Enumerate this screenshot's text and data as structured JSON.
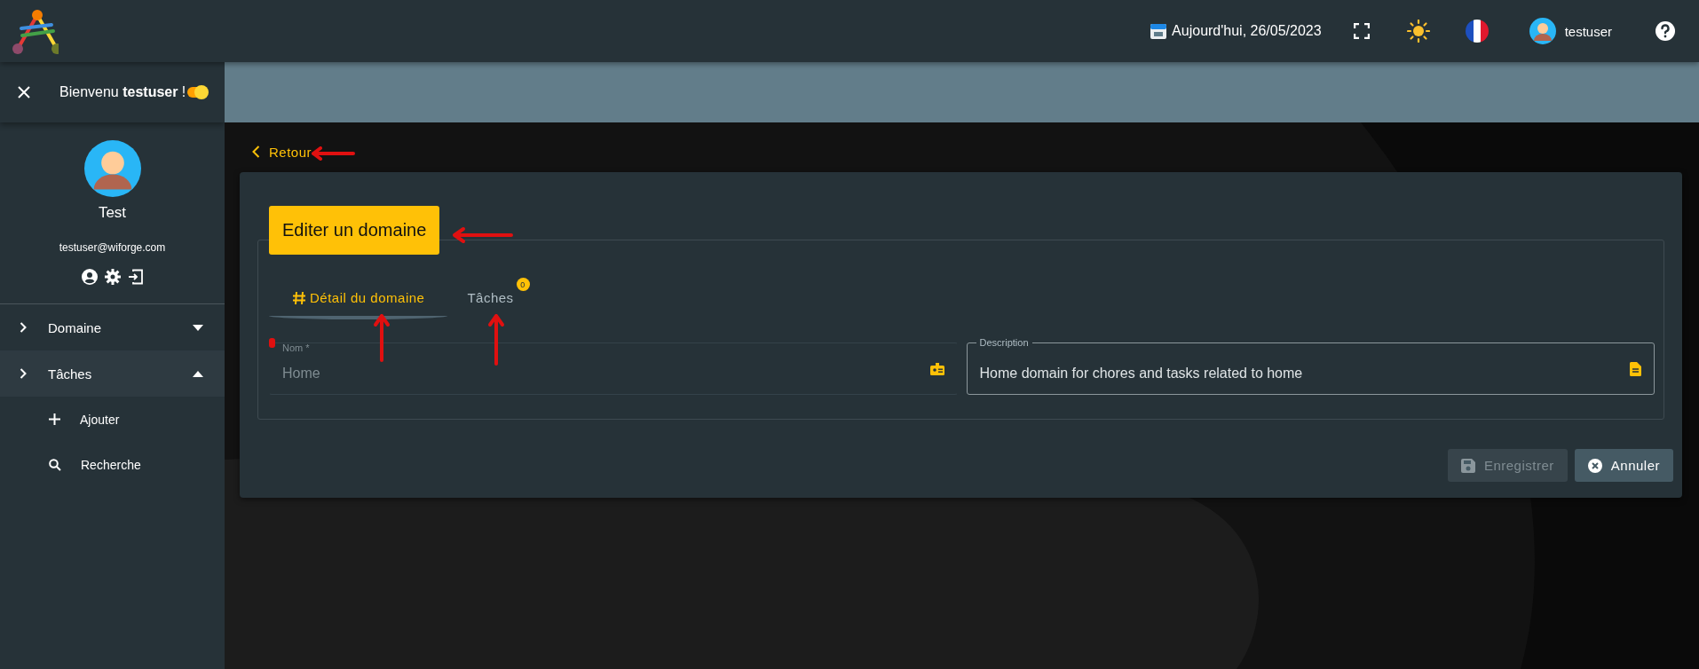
{
  "top_bar": {
    "date": "Aujourd'hui, 26/05/2023",
    "user": "testuser"
  },
  "sidebar": {
    "greeting": "Bienvenu **testuser** !",
    "toggle_on": true,
    "profile": {
      "name": "Test",
      "email": "testuser@wiforge.com"
    },
    "nav": [
      {
        "label": "Domaine",
        "expanded": false
      },
      {
        "label": "Tâches",
        "expanded": true,
        "children": [
          {
            "label": "Ajouter",
            "kind": "add"
          },
          {
            "label": "Recherche",
            "kind": "search"
          }
        ]
      }
    ]
  },
  "back_link": "Retour",
  "form": {
    "title": "Editer un domaine",
    "tabs": [
      {
        "label": "Détail du domaine",
        "selected": true
      },
      {
        "label": "Tâches",
        "selected": false,
        "badge": "0"
      }
    ],
    "fields": [
      {
        "label": "Nom *",
        "value": "Home",
        "disabled": true,
        "kind": "badge"
      },
      {
        "label": "Description",
        "value": "Home domain for chores and tasks related to home",
        "disabled": false,
        "kind": "document"
      }
    ],
    "buttons": [
      {
        "label": "Enregistrer",
        "kind": "save",
        "disabled": true
      },
      {
        "label": "Annuler",
        "kind": "cancel",
        "disabled": false
      }
    ]
  }
}
